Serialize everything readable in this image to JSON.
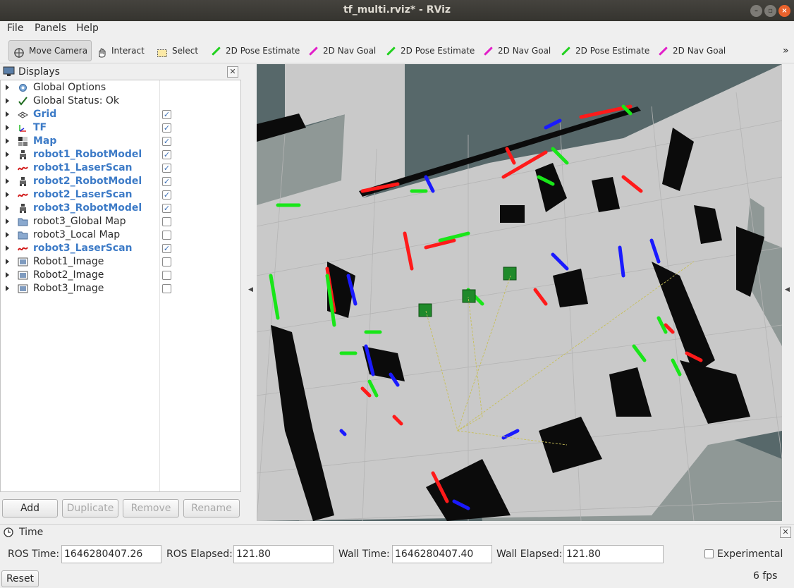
{
  "window": {
    "title": "tf_multi.rviz* - RViz"
  },
  "menu": {
    "items": [
      "File",
      "Panels",
      "Help"
    ]
  },
  "toolbar": {
    "tools": [
      {
        "label": "Move Camera",
        "icon": "move-camera-icon",
        "active": true
      },
      {
        "label": "Interact",
        "icon": "hand-icon"
      },
      {
        "label": "Select",
        "icon": "select-box-icon"
      },
      {
        "label": "2D Pose Estimate",
        "icon": "green-arrow-icon"
      },
      {
        "label": "2D Nav Goal",
        "icon": "magenta-arrow-icon"
      },
      {
        "label": "2D Pose Estimate",
        "icon": "green-arrow-icon"
      },
      {
        "label": "2D Nav Goal",
        "icon": "magenta-arrow-icon"
      },
      {
        "label": "2D Pose Estimate",
        "icon": "green-arrow-icon"
      },
      {
        "label": "2D Nav Goal",
        "icon": "magenta-arrow-icon"
      }
    ],
    "overflow": "»"
  },
  "displays": {
    "title": "Displays",
    "items": [
      {
        "label": "Global Options",
        "icon": "gear-icon",
        "enabled": null
      },
      {
        "label": "Global Status: Ok",
        "icon": "check-icon",
        "enabled": null
      },
      {
        "label": "Grid",
        "icon": "grid-icon",
        "enabled": true
      },
      {
        "label": "TF",
        "icon": "tf-icon",
        "enabled": true
      },
      {
        "label": "Map",
        "icon": "map-icon",
        "enabled": true
      },
      {
        "label": "robot1_RobotModel",
        "icon": "robot-model-icon",
        "enabled": true
      },
      {
        "label": "robot1_LaserScan",
        "icon": "laser-scan-icon",
        "enabled": true
      },
      {
        "label": "robot2_RobotModel",
        "icon": "robot-model-icon",
        "enabled": true
      },
      {
        "label": "robot2_LaserScan",
        "icon": "laser-scan-icon",
        "enabled": true
      },
      {
        "label": "robot3_RobotModel",
        "icon": "robot-model-icon",
        "enabled": true
      },
      {
        "label": "robot3_Global Map",
        "icon": "folder-icon",
        "enabled": false
      },
      {
        "label": "robot3_Local Map",
        "icon": "folder-icon",
        "enabled": false
      },
      {
        "label": "robot3_LaserScan",
        "icon": "laser-scan-icon",
        "enabled": true
      },
      {
        "label": "Robot1_Image",
        "icon": "image-icon",
        "enabled": false
      },
      {
        "label": "Robot2_Image",
        "icon": "image-icon",
        "enabled": false
      },
      {
        "label": "Robot3_Image",
        "icon": "image-icon",
        "enabled": false
      }
    ],
    "buttons": {
      "add": "Add",
      "duplicate": "Duplicate",
      "remove": "Remove",
      "rename": "Rename"
    }
  },
  "time": {
    "title": "Time",
    "ros_time_label": "ROS Time:",
    "ros_time": "1646280407.26",
    "ros_elapsed_label": "ROS Elapsed:",
    "ros_elapsed": "121.80",
    "wall_time_label": "Wall Time:",
    "wall_time": "1646280407.40",
    "wall_elapsed_label": "Wall Elapsed:",
    "wall_elapsed": "121.80",
    "experimental_label": "Experimental",
    "experimental": false,
    "reset_label": "Reset",
    "fps": "6 fps"
  },
  "colors": {
    "viewport_bg": "#57686a",
    "map_free": "#c9c9c9",
    "map_unknown": "#8f9896",
    "obstacle": "#0b0b0b",
    "scan_red": "#ff1a1a",
    "scan_green": "#19e619",
    "scan_blue": "#1a1aff",
    "display_label_blue": "#3d7bc7"
  }
}
